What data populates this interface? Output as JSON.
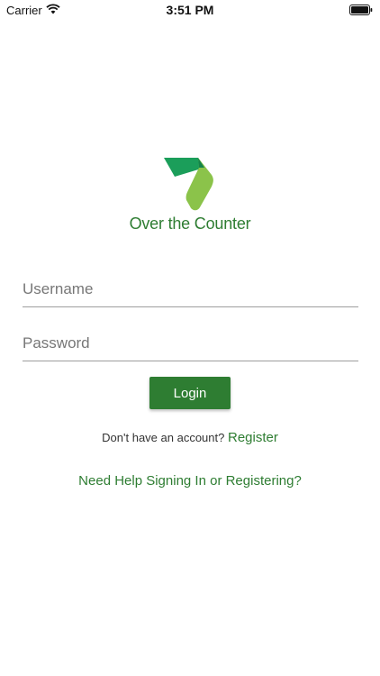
{
  "status_bar": {
    "carrier": "Carrier",
    "time": "3:51 PM",
    "wifi_icon": "wifi-icon",
    "battery_icon": "battery-icon"
  },
  "brand": {
    "name": "Over the Counter",
    "logo_icon": "leaf-logo-icon",
    "colors": {
      "primary": "#2e7d32",
      "logo_dark": "#1b9e5a",
      "logo_light": "#8bc34a"
    }
  },
  "form": {
    "username_placeholder": "Username",
    "username_value": "",
    "password_placeholder": "Password",
    "password_value": "",
    "login_label": "Login"
  },
  "register": {
    "prompt": "Don't have an account?",
    "link_label": "Register"
  },
  "help": {
    "link_label": "Need Help Signing In or Registering?"
  }
}
